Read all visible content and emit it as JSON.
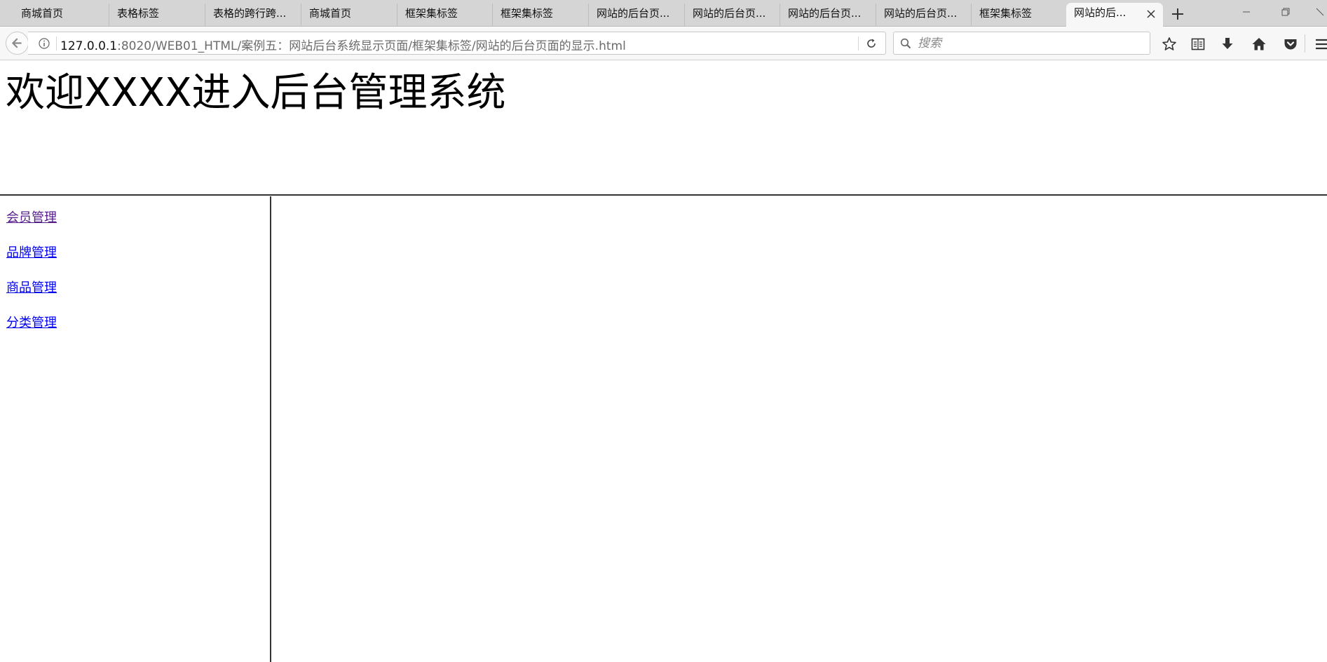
{
  "browser": {
    "tabs": [
      {
        "label": "商城首页"
      },
      {
        "label": "表格标签"
      },
      {
        "label": "表格的跨行跨..."
      },
      {
        "label": "商城首页"
      },
      {
        "label": "框架集标签"
      },
      {
        "label": "框架集标签"
      },
      {
        "label": "网站的后台页..."
      },
      {
        "label": "网站的后台页..."
      },
      {
        "label": "网站的后台页..."
      },
      {
        "label": "网站的后台页..."
      },
      {
        "label": "框架集标签"
      },
      {
        "label": "网站的后..."
      }
    ],
    "active_tab_index": 11,
    "url_host": "127.0.0.1",
    "url_rest": ":8020/WEB01_HTML/案例五：网站后台系统显示页面/框架集标签/网站的后台页面的显示.html",
    "search_placeholder": "搜索",
    "icons": {
      "back": "back-arrow-icon",
      "info": "info-icon",
      "reload": "reload-icon",
      "search": "search-icon",
      "bookmark": "star-icon",
      "reader": "reading-list-icon",
      "download": "download-icon",
      "home": "home-icon",
      "pocket": "pocket-icon",
      "menu": "hamburger-menu-icon",
      "new_tab": "plus-icon",
      "close_tab": "close-icon"
    }
  },
  "page": {
    "title": "欢迎XXXX进入后台管理系统",
    "menu": [
      {
        "label": "会员管理",
        "visited": true
      },
      {
        "label": "品牌管理",
        "visited": false
      },
      {
        "label": "商品管理",
        "visited": false
      },
      {
        "label": "分类管理",
        "visited": false
      }
    ],
    "colors": {
      "link": "#0000ee",
      "visited_link": "#551a8b",
      "frame_border": "#333333"
    }
  }
}
